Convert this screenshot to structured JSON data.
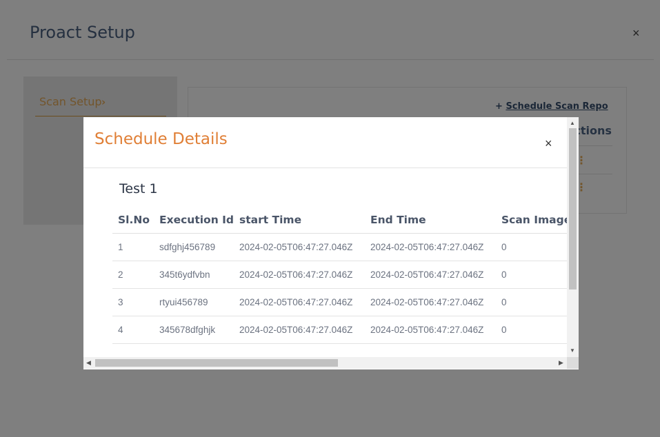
{
  "page": {
    "title": "Proact Setup",
    "close_icon": "×"
  },
  "sidebar": {
    "items": [
      {
        "label": "Scan Setup",
        "chevron": "›"
      }
    ]
  },
  "content": {
    "schedule_link_plus": "+",
    "schedule_link_label": "Schedule Scan Repo",
    "actions_header": "Actions",
    "kebab_icon": "⋮"
  },
  "modal": {
    "title": "Schedule Details",
    "close_icon": "×",
    "schedule_name": "Test 1",
    "table": {
      "columns": [
        "Sl.No",
        "Execution Id",
        "start Time",
        "End Time",
        "Scan Images"
      ],
      "rows": [
        [
          "1",
          "sdfghj456789",
          "2024-02-05T06:47:27.046Z",
          "2024-02-05T06:47:27.046Z",
          "0"
        ],
        [
          "2",
          "345t6ydfvbn",
          "2024-02-05T06:47:27.046Z",
          "2024-02-05T06:47:27.046Z",
          "0"
        ],
        [
          "3",
          "rtyui456789",
          "2024-02-05T06:47:27.046Z",
          "2024-02-05T06:47:27.046Z",
          "0"
        ],
        [
          "4",
          "345678dfghjk",
          "2024-02-05T06:47:27.046Z",
          "2024-02-05T06:47:27.046Z",
          "0"
        ]
      ]
    }
  },
  "scrollbars": {
    "up_arrow": "▲",
    "down_arrow": "▼",
    "left_arrow": "◀",
    "right_arrow": "▶"
  },
  "colors": {
    "overlay": "#7f7f7f",
    "modal_title": "#e07f36",
    "accent": "#e07f36"
  }
}
